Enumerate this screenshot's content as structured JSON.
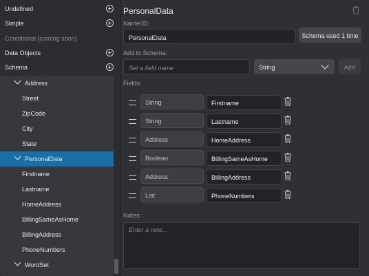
{
  "sidebar": {
    "top_items": [
      {
        "label": "Undefined",
        "has_add": true
      },
      {
        "label": "Simple",
        "has_add": true
      },
      {
        "label": "Conditional (coming soon)",
        "has_add": false,
        "disabled": true
      },
      {
        "label": "Data Objects",
        "has_add": true
      },
      {
        "label": "Schema",
        "has_add": true
      }
    ],
    "tree": [
      {
        "label": "Address",
        "expanded": true
      },
      {
        "label": "Street"
      },
      {
        "label": "ZipCode"
      },
      {
        "label": "City"
      },
      {
        "label": "State"
      },
      {
        "label": "PersonalData",
        "expanded": true,
        "selected": true
      },
      {
        "label": "Firstname"
      },
      {
        "label": "Lastname"
      },
      {
        "label": "HomeAddress"
      },
      {
        "label": "BillingSameAsHome"
      },
      {
        "label": "BillingAddress"
      },
      {
        "label": "PhoneNumbers"
      },
      {
        "label": "WordSet",
        "expanded": true
      }
    ]
  },
  "main": {
    "title": "PersonalData",
    "name_label": "Name/ID:",
    "name_value": "PersonalData",
    "schema_used_label": "Schema used 1 time",
    "add_to_schema_label": "Add to Schema:",
    "field_name_placeholder": "Set a field name",
    "type_select_value": "String",
    "add_button_label": "Add",
    "fields_label": "Fields:",
    "fields": [
      {
        "type": "String",
        "name": "Firstname"
      },
      {
        "type": "String",
        "name": "Lastname"
      },
      {
        "type": "Address",
        "name": "HomeAddress"
      },
      {
        "type": "Boolean",
        "name": "BillingSameAsHome"
      },
      {
        "type": "Address",
        "name": "BillingAddress"
      },
      {
        "type": "List",
        "name": "PhoneNumbers"
      }
    ],
    "notes_label": "Notes:",
    "notes_placeholder": "Enter a note..."
  },
  "colors": {
    "background": "#2e3034",
    "sidebar": "#2b2d31",
    "tree_panel": "#36383d",
    "selected": "#1a6fa8",
    "input_bg": "#222327"
  }
}
